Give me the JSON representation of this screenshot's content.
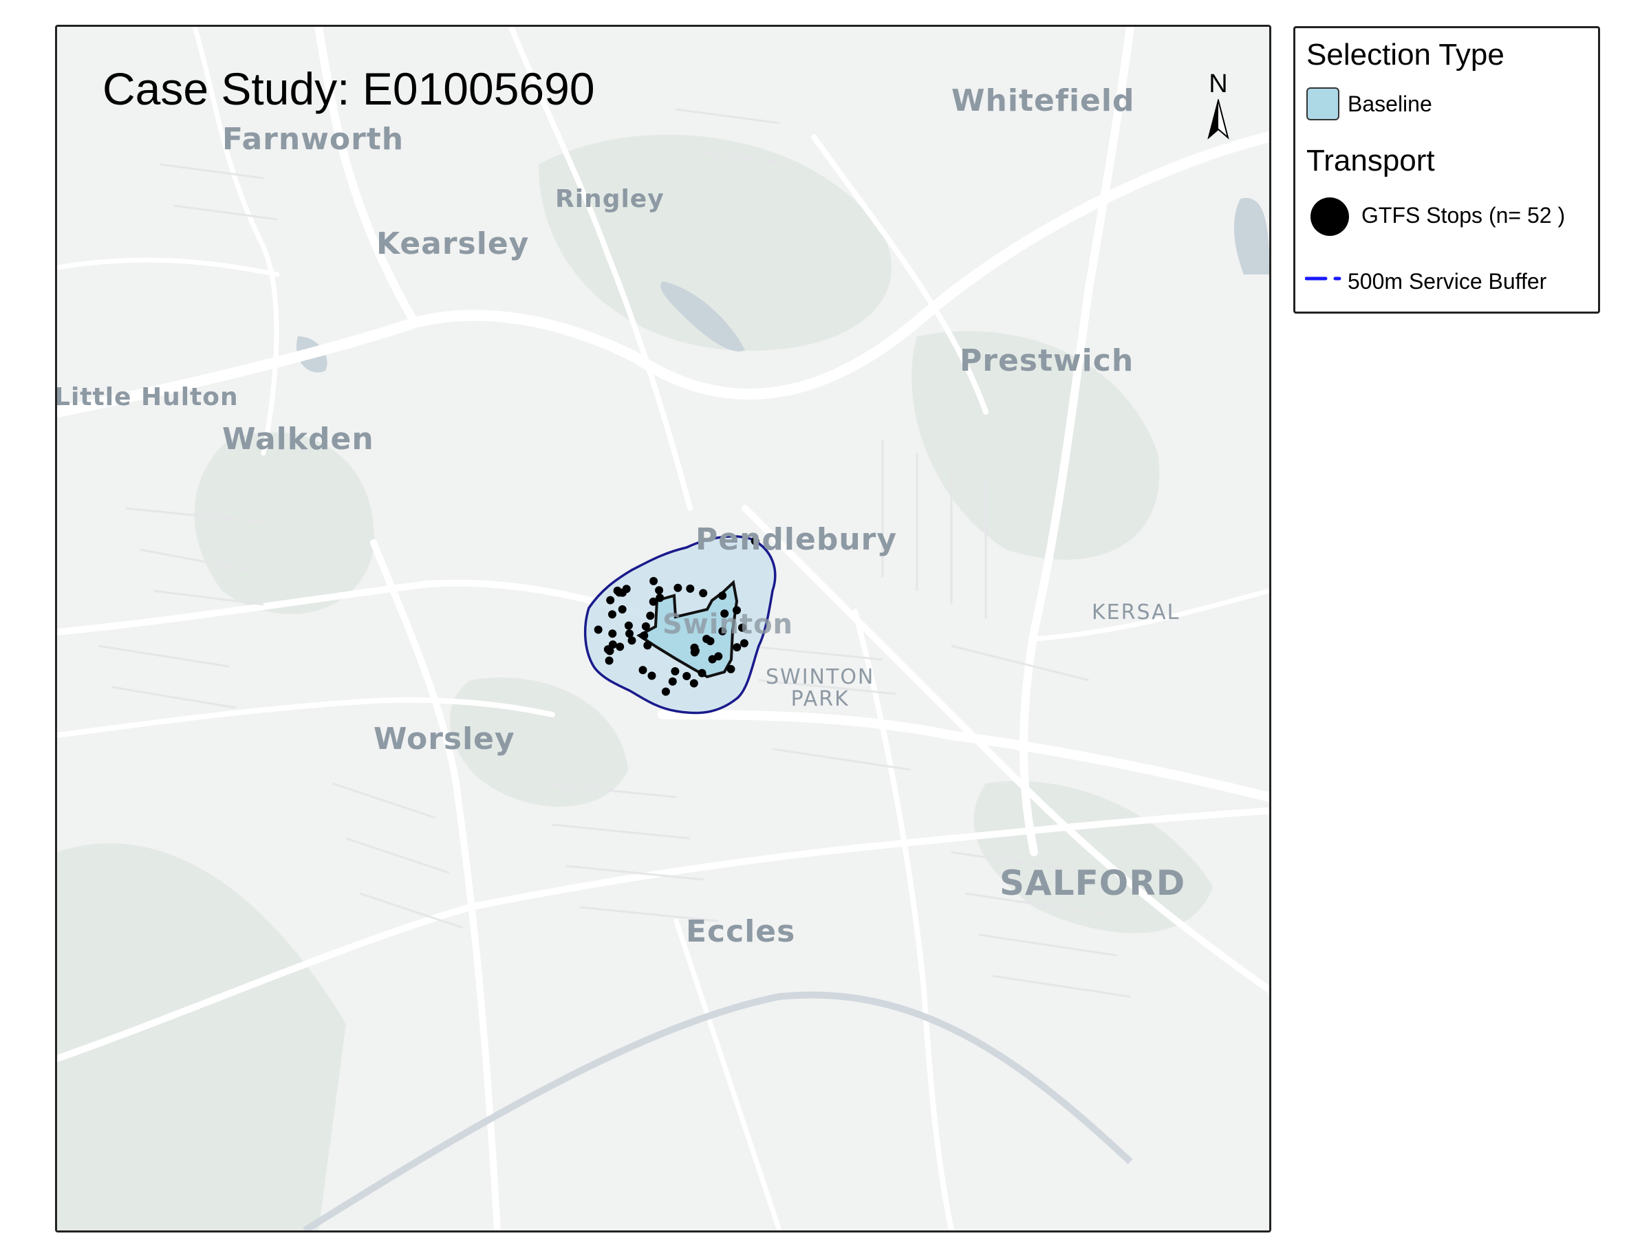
{
  "title": "Case Study: E01005690",
  "north_label": "N",
  "places": [
    {
      "name": "Farnworth",
      "style": "large"
    },
    {
      "name": "Whitefield",
      "style": "large"
    },
    {
      "name": "Ringley",
      "style": "medium"
    },
    {
      "name": "Kearsley",
      "style": "large"
    },
    {
      "name": "Prestwich",
      "style": "large"
    },
    {
      "name": "Little Hulton",
      "style": "medium"
    },
    {
      "name": "Walkden",
      "style": "large"
    },
    {
      "name": "Pendlebury",
      "style": "large"
    },
    {
      "name": "Swinton",
      "style": "large"
    },
    {
      "name": "KERSAL",
      "style": "small"
    },
    {
      "name": "SWINTON\nPARK",
      "style": "small"
    },
    {
      "name": "Worsley",
      "style": "large"
    },
    {
      "name": "SALFORD",
      "style": "xlarge"
    },
    {
      "name": "Eccles",
      "style": "large"
    }
  ],
  "legend": {
    "selection_heading": "Selection Type",
    "baseline_label": "Baseline",
    "transport_heading": "Transport",
    "stops_label": "GTFS Stops (n= 52 )",
    "buffer_label": "500m Service Buffer"
  },
  "colors": {
    "map_background": "#f1f2f2",
    "baseline_fill": "#add8e6",
    "buffer_line": "#1a1a8c",
    "stop_fill": "#000000",
    "place_label": "#8d99a3",
    "road": "#ffffff",
    "green_area": "#e3e9e5",
    "water": "#c9d3da"
  },
  "icons": {
    "north_arrow": "north-arrow-icon",
    "stop_symbol": "filled-circle",
    "buffer_symbol": "dashed-line"
  },
  "stops_count": 52
}
